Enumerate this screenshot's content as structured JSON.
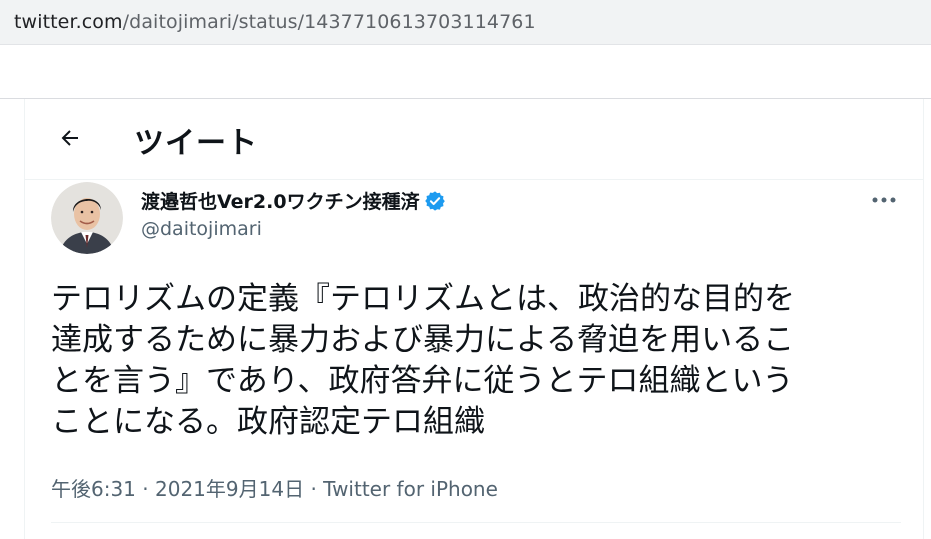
{
  "browser": {
    "url_host": "twitter.com",
    "url_path": "/daitojimari/status/1437710613703114761"
  },
  "header": {
    "title": "ツイート",
    "back_icon": "arrow-left-icon"
  },
  "author": {
    "display_name": "渡邉哲也Ver2.0ワクチン接種済",
    "handle": "@daitojimari",
    "verified": true,
    "verified_color": "#1d9bf0"
  },
  "tweet": {
    "text_lines": [
      "テロリズムの定義『テロリズムとは、政治的な目的を",
      "達成するために暴力および暴力による脅迫を用いるこ",
      "とを言う』であり、政府答弁に従うとテロ組織という",
      "ことになる。政府認定テロ組織"
    ],
    "time": "午後6:31",
    "date": "2021年9月14日",
    "separator": "·",
    "source": "Twitter for iPhone"
  },
  "colors": {
    "text": "#0f1419",
    "secondary": "#536471",
    "border": "#eff3f4"
  }
}
